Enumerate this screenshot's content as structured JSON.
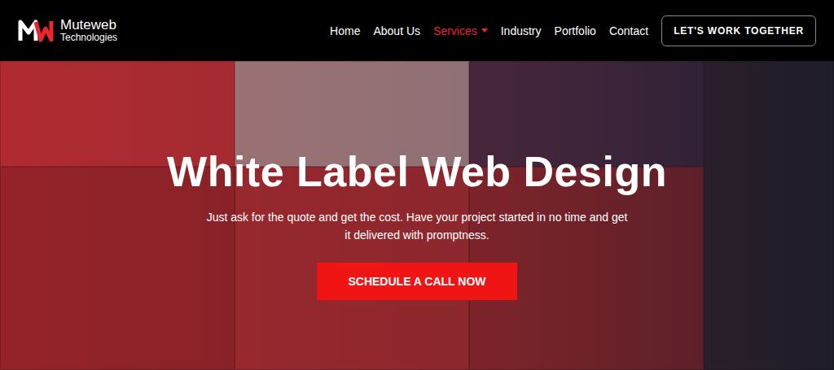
{
  "header": {
    "logo": {
      "name": "Muteweb",
      "tagline": "Technologies"
    },
    "nav": [
      {
        "label": "Home",
        "selected": false,
        "dropdown": false
      },
      {
        "label": "About Us",
        "selected": false,
        "dropdown": false
      },
      {
        "label": "Services",
        "selected": true,
        "dropdown": true
      },
      {
        "label": "Industry",
        "selected": false,
        "dropdown": false
      },
      {
        "label": "Portfolio",
        "selected": false,
        "dropdown": false
      },
      {
        "label": "Contact",
        "selected": false,
        "dropdown": false
      }
    ],
    "cta": "LET'S WORK TOGETHER"
  },
  "hero": {
    "title": "White Label Web Design",
    "subtitle": "Just ask for the quote and get the cost. Have your project started in no time and get it delivered with promptness.",
    "button": "SCHEDULE A CALL NOW"
  }
}
